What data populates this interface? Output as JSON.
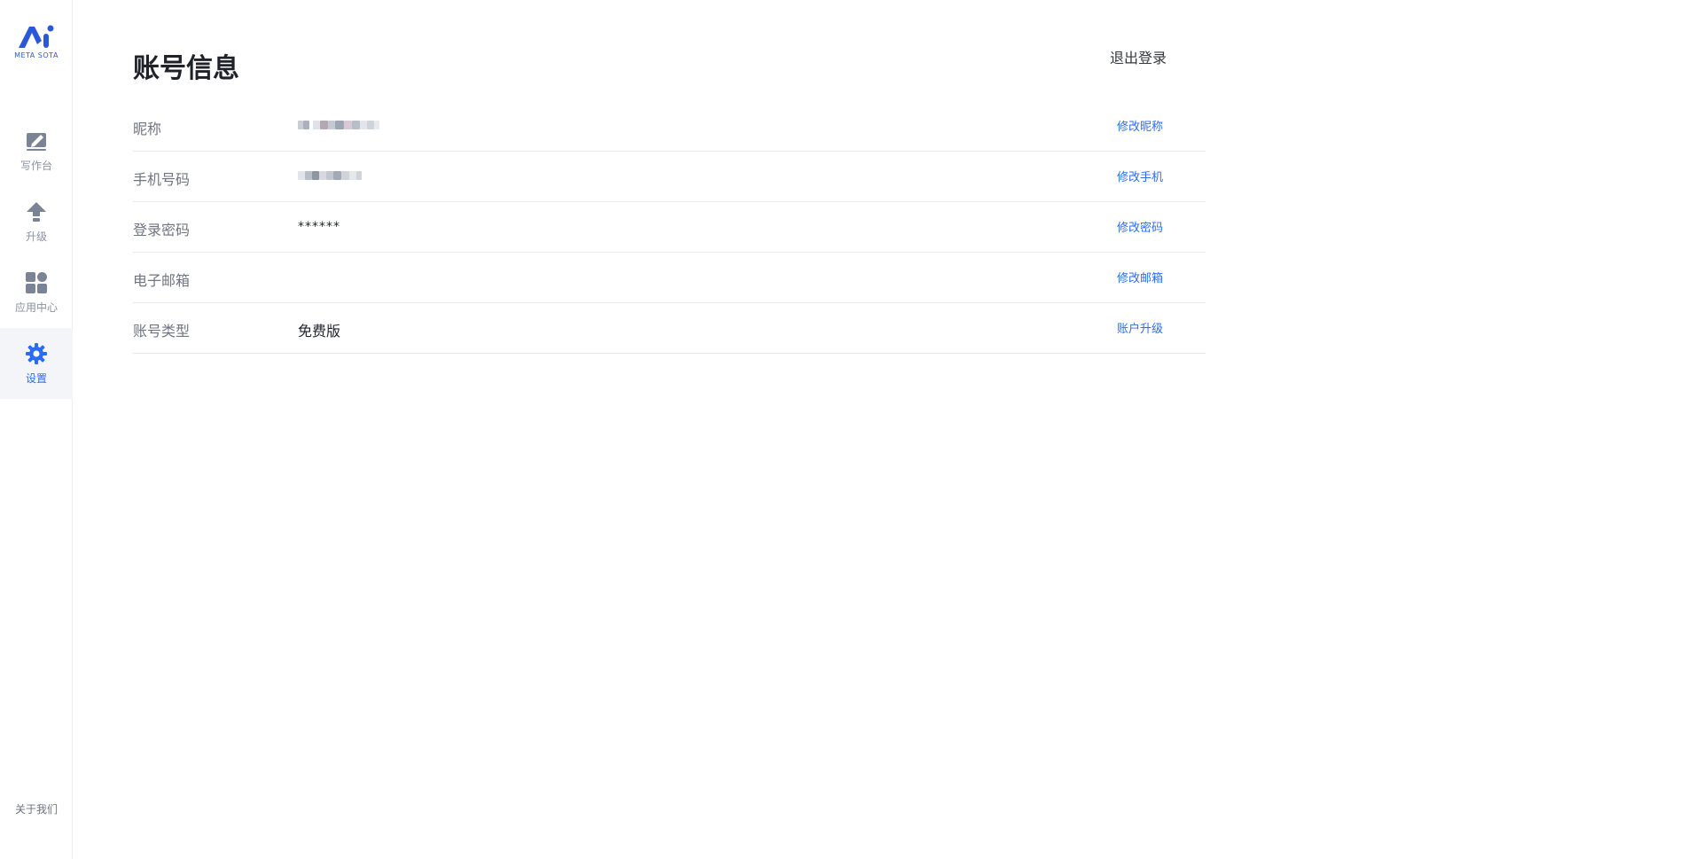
{
  "sidebar": {
    "logo_text": "META SOTA",
    "items": [
      {
        "label": "写作台",
        "icon": "edit-icon"
      },
      {
        "label": "升级",
        "icon": "arrow-up-icon"
      },
      {
        "label": "应用中心",
        "icon": "apps-grid-icon"
      },
      {
        "label": "设置",
        "icon": "gear-icon"
      }
    ],
    "about": "关于我们"
  },
  "main": {
    "title": "账号信息",
    "logout": "退出登录",
    "rows": [
      {
        "label": "昵称",
        "value": "",
        "action": "修改昵称"
      },
      {
        "label": "手机号码",
        "value": "",
        "action": "修改手机"
      },
      {
        "label": "登录密码",
        "value": "******",
        "action": "修改密码"
      },
      {
        "label": "电子邮箱",
        "value": "",
        "action": "修改邮箱"
      },
      {
        "label": "账号类型",
        "value": "免费版",
        "action": "账户升级"
      }
    ]
  },
  "colors": {
    "accent": "#2b6cf5",
    "brand": "#2b58d9",
    "sidebar_active_bg": "#f3f5f9",
    "nav_inactive": "#8a919f"
  }
}
